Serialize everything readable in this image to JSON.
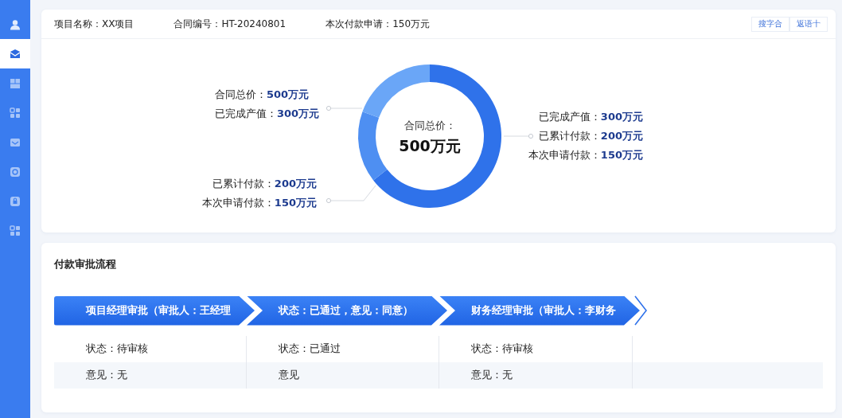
{
  "sidebar": {
    "items": [
      {
        "kind": "person",
        "selected": false
      },
      {
        "kind": "inbox",
        "selected": true
      },
      {
        "kind": "tiles",
        "selected": false
      },
      {
        "kind": "apps",
        "selected": false
      },
      {
        "kind": "mail",
        "selected": false
      },
      {
        "kind": "chart",
        "selected": false
      },
      {
        "kind": "lock",
        "selected": false
      },
      {
        "kind": "apps",
        "selected": false
      }
    ]
  },
  "header": {
    "fields": [
      "项目名称：XX项目",
      "合同编号：HT-20240801",
      "本次付款申请：150万元"
    ],
    "buttons": [
      "搜字合",
      "返语十"
    ]
  },
  "summary": {
    "center_label": "合同总价：",
    "center_value": "500万元",
    "callouts": [
      {
        "items": [
          {
            "label": "合同总价：",
            "value": "500万元"
          },
          {
            "label": "已完成产值：",
            "value": "300万元"
          }
        ]
      },
      {
        "items": [
          {
            "label": "已累计付款：",
            "value": "200万元"
          },
          {
            "label": "本次申请付款：",
            "value": "150万元"
          }
        ]
      },
      {
        "items": [
          {
            "label": "已完成产值：",
            "value": "300万元"
          },
          {
            "label": "已累计付款：",
            "value": "200万元"
          },
          {
            "label": "本次申请付款：",
            "value": "150万元"
          }
        ]
      }
    ]
  },
  "flow": {
    "title": "付款审批流程",
    "steps": [
      "项目经理审批（审批人：王经理",
      "状态：已通过，意见：同意）",
      "财务经理审批（审批人：李财务"
    ],
    "rows": [
      [
        "状态：待审核",
        "状态：已通过",
        "状态：待审核"
      ],
      [
        "意见：无",
        "意见",
        "意见：无"
      ]
    ]
  }
}
